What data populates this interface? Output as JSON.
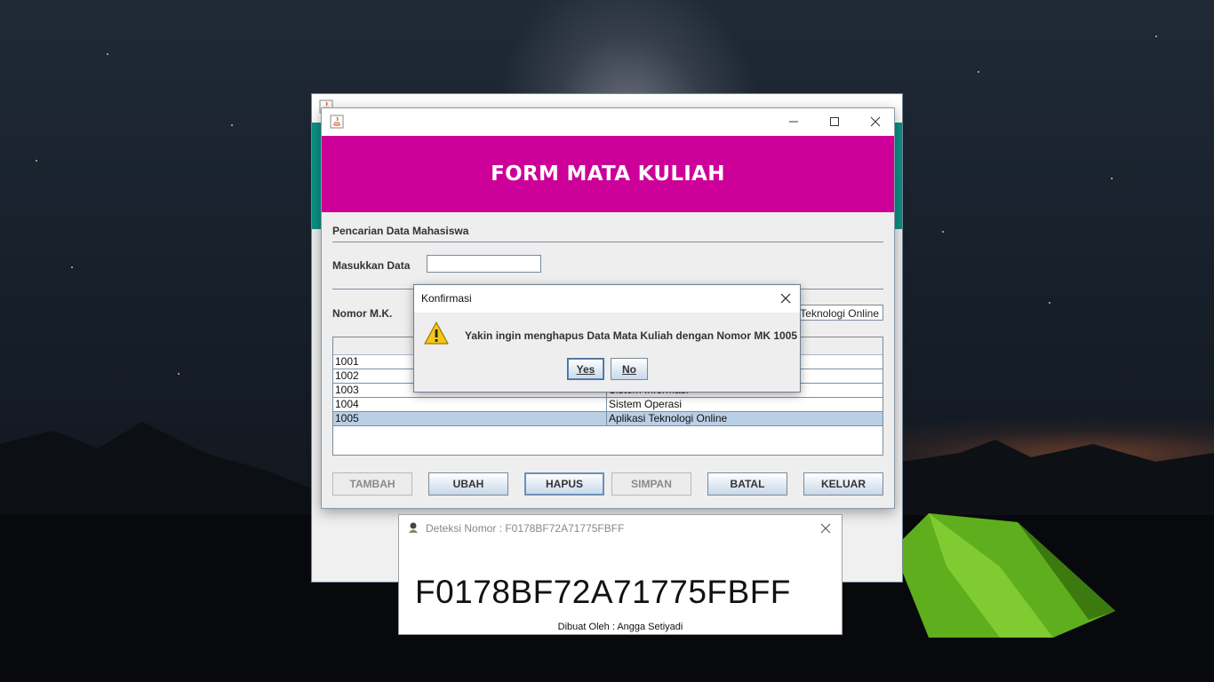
{
  "back_window": {
    "accent_color": "#0b9286"
  },
  "main_window": {
    "header_title": "FORM MATA KULIAH",
    "header_color": "#cc0099",
    "search_section_title": "Pencarian Data Mahasiswa",
    "search_label": "Masukkan Data",
    "search_value": "",
    "nomor_label": "Nomor M.K.",
    "nama_field_value": "Aplikasi Teknologi Online",
    "table": {
      "columns": [
        "",
        ""
      ],
      "rows": [
        {
          "nomor": "1001",
          "nama": ""
        },
        {
          "nomor": "1002",
          "nama": ""
        },
        {
          "nomor": "1003",
          "nama": "Sistem Informasi"
        },
        {
          "nomor": "1004",
          "nama": "Sistem Operasi"
        },
        {
          "nomor": "1005",
          "nama": "Aplikasi Teknologi Online"
        }
      ],
      "selected_row": 4
    },
    "buttons": {
      "tambah": "TAMBAH",
      "ubah": "UBAH",
      "hapus": "HAPUS",
      "simpan": "SIMPAN",
      "batal": "BATAL",
      "keluar": "KELUAR"
    }
  },
  "dialog": {
    "title": "Konfirmasi",
    "message": "Yakin ingin menghapus Data Mata Kuliah dengan Nomor MK 1005",
    "yes_label": "Yes",
    "no_label": "No",
    "icon": "warning-icon"
  },
  "detection_window": {
    "title": "Deteksi Nomor : F0178BF72A71775FBFF",
    "code": "F0178BF72A71775FBFF",
    "credit": "Dibuat Oleh : Angga Setiyadi"
  }
}
